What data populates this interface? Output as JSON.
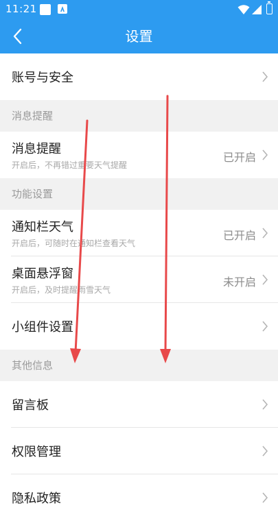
{
  "status_bar": {
    "time": "11:21",
    "icons": [
      "notification-square-icon",
      "notification-a-icon",
      "wifi-icon",
      "signal-icon",
      "battery-icon"
    ]
  },
  "nav": {
    "title": "设置",
    "back_icon": "back-arrow-icon"
  },
  "rows": {
    "account": {
      "title": "账号与安全"
    },
    "msg_remind": {
      "title": "消息提醒",
      "subtitle": "开启后，不再错过重要天气提醒",
      "value": "已开启"
    },
    "notif_bar_weather": {
      "title": "通知栏天气",
      "subtitle": "开启后，可随时在通知栏查看天气",
      "value": "已开启"
    },
    "desktop_float": {
      "title": "桌面悬浮窗",
      "subtitle": "开启后，及时提醒雨雪天气",
      "value": "未开启"
    },
    "widget_settings": {
      "title": "小组件设置"
    },
    "message_board": {
      "title": "留言板"
    },
    "permission_mgmt": {
      "title": "权限管理"
    },
    "privacy_policy": {
      "title": "隐私政策"
    }
  },
  "sections": {
    "message": "消息提醒",
    "function": "功能设置",
    "other": "其他信息"
  },
  "colors": {
    "primary": "#2d9bf0",
    "background": "#f1f1f1",
    "card": "#ffffff",
    "title_text": "#222222",
    "sub_text": "#a8a8a8",
    "value_text": "#8c8c8c",
    "section_text": "#9a9a9a",
    "annotation_arrow": "#e8494a"
  }
}
